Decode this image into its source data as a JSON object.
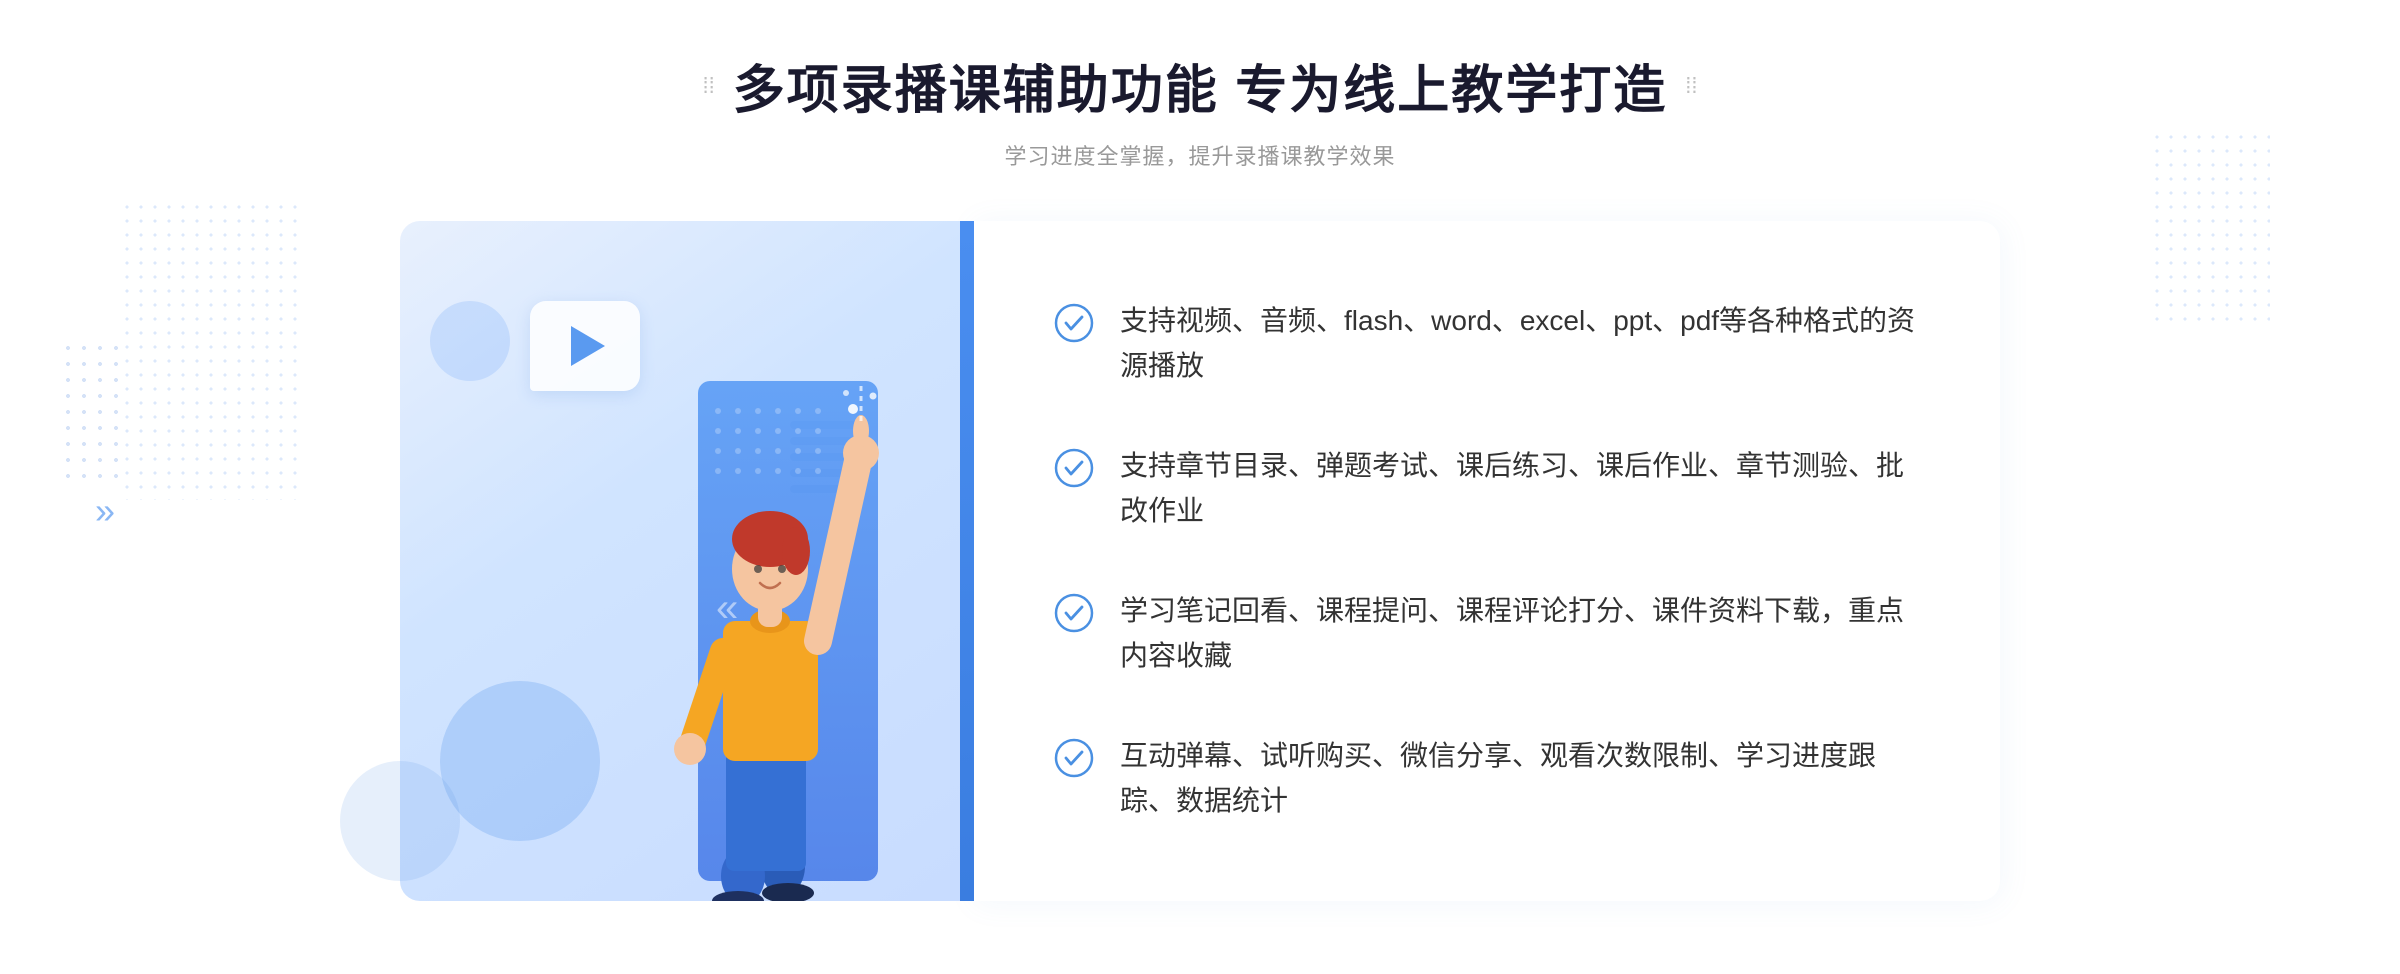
{
  "header": {
    "title": "多项录播课辅助功能 专为线上教学打造",
    "subtitle": "学习进度全掌握，提升录播课教学效果",
    "deco_left": "⁞⁞",
    "deco_right": "⁞⁞"
  },
  "features": [
    {
      "id": 1,
      "text": "支持视频、音频、flash、word、excel、ppt、pdf等各种格式的资源播放"
    },
    {
      "id": 2,
      "text": "支持章节目录、弹题考试、课后练习、课后作业、章节测验、批改作业"
    },
    {
      "id": 3,
      "text": "学习笔记回看、课程提问、课程评论打分、课件资料下载，重点内容收藏"
    },
    {
      "id": 4,
      "text": "互动弹幕、试听购买、微信分享、观看次数限制、学习进度跟踪、数据统计"
    }
  ],
  "arrow_left": "»",
  "check_icon_color": "#4a90e2",
  "accent_color": "#4a8ef0",
  "background_color": "#ffffff"
}
